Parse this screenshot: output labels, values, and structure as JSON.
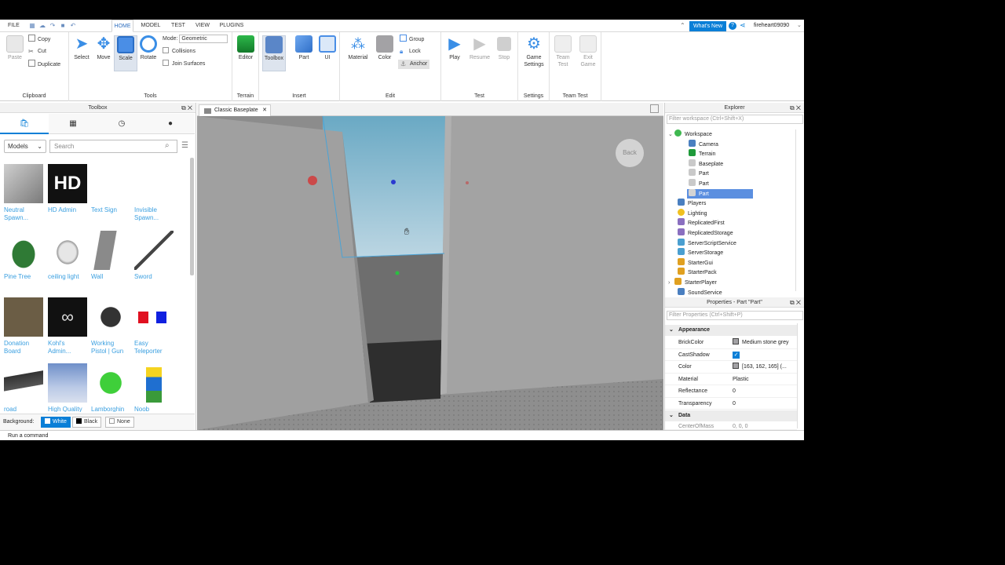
{
  "menu": {
    "file": "FILE",
    "tabs": [
      "HOME",
      "MODEL",
      "TEST",
      "VIEW",
      "PLUGINS"
    ],
    "active_tab": "HOME",
    "whats_new": "What's New",
    "username": "fireheart09090"
  },
  "ribbon": {
    "clipboard": {
      "label": "Clipboard",
      "paste": "Paste",
      "copy": "Copy",
      "cut": "Cut",
      "duplicate": "Duplicate"
    },
    "tools": {
      "label": "Tools",
      "select": "Select",
      "move": "Move",
      "scale": "Scale",
      "rotate": "Rotate",
      "mode_label": "Mode:",
      "mode_value": "Geometric",
      "collisions": "Collisions",
      "join_surfaces": "Join Surfaces"
    },
    "terrain": {
      "label": "Terrain",
      "editor": "Editor"
    },
    "insert": {
      "label": "Insert",
      "toolbox": "Toolbox",
      "part": "Part",
      "ui": "UI"
    },
    "edit": {
      "label": "Edit",
      "material": "Material",
      "color": "Color",
      "group": "Group",
      "lock": "Lock",
      "anchor": "Anchor"
    },
    "test": {
      "label": "Test",
      "play": "Play",
      "resume": "Resume",
      "stop": "Stop"
    },
    "settings": {
      "label": "Settings",
      "game_settings_1": "Game",
      "game_settings_2": "Settings"
    },
    "team_test": {
      "label": "Team Test",
      "team_test_1": "Team",
      "team_test_2": "Test",
      "exit_game_1": "Exit",
      "exit_game_2": "Game"
    }
  },
  "toolbox": {
    "title": "Toolbox",
    "category": "Models",
    "search_placeholder": "Search",
    "items": [
      {
        "name1": "Neutral",
        "name2": "Spawn..."
      },
      {
        "name1": "HD Admin",
        "name2": ""
      },
      {
        "name1": "Text Sign",
        "name2": ""
      },
      {
        "name1": "Invisible",
        "name2": "Spawn..."
      },
      {
        "name1": "Pine Tree",
        "name2": ""
      },
      {
        "name1": "ceiling light",
        "name2": ""
      },
      {
        "name1": "Wall",
        "name2": ""
      },
      {
        "name1": "Sword",
        "name2": ""
      },
      {
        "name1": "Donation",
        "name2": "Board"
      },
      {
        "name1": "Kohl's",
        "name2": "Admin..."
      },
      {
        "name1": "Working",
        "name2": "Pistol | Gun"
      },
      {
        "name1": "Easy",
        "name2": "Teleporter"
      },
      {
        "name1": "road",
        "name2": ""
      },
      {
        "name1": "High Quality",
        "name2": ""
      },
      {
        "name1": "Lamborghin",
        "name2": ""
      },
      {
        "name1": "Noob",
        "name2": ""
      }
    ],
    "hd_logo": "HD",
    "background_label": "Background:",
    "bg_white": "White",
    "bg_black": "Black",
    "bg_none": "None"
  },
  "viewport": {
    "tab_label": "Classic Baseplate",
    "back_label": "Back"
  },
  "explorer": {
    "title": "Explorer",
    "filter_placeholder": "Filter workspace (Ctrl+Shift+X)",
    "nodes": [
      "Workspace",
      "Camera",
      "Terrain",
      "Baseplate",
      "Part",
      "Part",
      "Part",
      "Players",
      "Lighting",
      "ReplicatedFirst",
      "ReplicatedStorage",
      "ServerScriptService",
      "ServerStorage",
      "StarterGui",
      "StarterPack",
      "StarterPlayer",
      "SoundService"
    ]
  },
  "properties": {
    "title": "Properties - Part \"Part\"",
    "filter_placeholder": "Filter Properties (Ctrl+Shift+P)",
    "section_appearance": "Appearance",
    "section_data": "Data",
    "rows": [
      {
        "name": "BrickColor",
        "value": "Medium stone grey"
      },
      {
        "name": "CastShadow",
        "value": "✓"
      },
      {
        "name": "Color",
        "value": "[163, 162, 165] (..."
      },
      {
        "name": "Material",
        "value": "Plastic"
      },
      {
        "name": "Reflectance",
        "value": "0"
      },
      {
        "name": "Transparency",
        "value": "0"
      }
    ],
    "cut_row_name": "CenterOfMass",
    "cut_row_value": "0, 0, 0"
  },
  "command_bar": {
    "placeholder": "Run a command"
  },
  "colors": {
    "accent": "#0a7fd7",
    "swatch_grey": "#a3a2a5",
    "selection": "#5b8fe0"
  }
}
